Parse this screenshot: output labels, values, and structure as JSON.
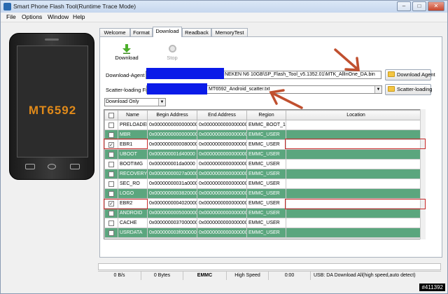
{
  "window": {
    "title": "Smart Phone Flash Tool(Runtime Trace Mode)",
    "controls": {
      "minimize": "–",
      "maximize": "□",
      "close": "✕"
    }
  },
  "menu": [
    "File",
    "Options",
    "Window",
    "Help"
  ],
  "phone": {
    "brand": "MT6592"
  },
  "tabs": [
    {
      "label": "Welcome",
      "active": false
    },
    {
      "label": "Format",
      "active": false
    },
    {
      "label": "Download",
      "active": true
    },
    {
      "label": "Readback",
      "active": false
    },
    {
      "label": "MemoryTest",
      "active": false
    }
  ],
  "toolbar": {
    "download_label": "Download",
    "stop_label": "Stop"
  },
  "download_agent": {
    "label": "Download-Agent",
    "value": "NEKEN N6 10GB\\SP_Flash_Tool_v5.1352.01\\MTK_AllInOne_DA.bin",
    "button": "Download Agent"
  },
  "scatter": {
    "label": "Scatter-loading File",
    "value": "MT6592_Android_scatter.txt",
    "button": "Scatter-loading"
  },
  "mode": {
    "value": "Download Only"
  },
  "table": {
    "columns": [
      "",
      "Name",
      "Begin Address",
      "End Address",
      "Region",
      "Location"
    ],
    "rows": [
      {
        "checked": false,
        "name": "PRELOADER",
        "begin": "0x0000000000000000",
        "end": "0x0000000000000000",
        "region": "EMMC_BOOT_1",
        "location": ""
      },
      {
        "checked": false,
        "name": "MBR",
        "begin": "0x0000000000000000",
        "end": "0x0000000000000000",
        "region": "EMMC_USER",
        "location": ""
      },
      {
        "checked": true,
        "name": "EBR1",
        "begin": "0x0000000000080000",
        "end": "0x0000000000000000",
        "region": "EMMC_USER",
        "location": ""
      },
      {
        "checked": false,
        "name": "UBOOT",
        "begin": "0x000000001d40000",
        "end": "0x0000000000000000",
        "region": "EMMC_USER",
        "location": ""
      },
      {
        "checked": false,
        "name": "BOOTIMG",
        "begin": "0x000000001da0000",
        "end": "0x0000000000000000",
        "region": "EMMC_USER",
        "location": ""
      },
      {
        "checked": false,
        "name": "RECOVERY",
        "begin": "0x00000000027a0000",
        "end": "0x0000000000000000",
        "region": "EMMC_USER",
        "location": ""
      },
      {
        "checked": false,
        "name": "SEC_RO",
        "begin": "0x00000000031a0000",
        "end": "0x0000000000000000",
        "region": "EMMC_USER",
        "location": ""
      },
      {
        "checked": false,
        "name": "LOGO",
        "begin": "0x0000000003820000",
        "end": "0x0000000000000000",
        "region": "EMMC_USER",
        "location": ""
      },
      {
        "checked": true,
        "name": "EBR2",
        "begin": "0x0000000004020000",
        "end": "0x0000000000000000",
        "region": "EMMC_USER",
        "location": ""
      },
      {
        "checked": false,
        "name": "ANDROID",
        "begin": "0x0000000005000000",
        "end": "0x0000000000000000",
        "region": "EMMC_USER",
        "location": ""
      },
      {
        "checked": false,
        "name": "CACHE",
        "begin": "0x0000000037000000",
        "end": "0x0000000000000000",
        "region": "EMMC_USER",
        "location": ""
      },
      {
        "checked": false,
        "name": "USRDATA",
        "begin": "0x000000003f000000",
        "end": "0x0000000000000000",
        "region": "EMMC_USER",
        "location": ""
      }
    ]
  },
  "status": {
    "speed": "0 B/s",
    "bytes": "0 Bytes",
    "storage": "EMMC",
    "mode": "High Speed",
    "time": "0:00",
    "info": "USB: DA Download All(high speed,auto detect)"
  },
  "watermark": "#411392",
  "colors": {
    "row_green": "#5ba67e",
    "redact": "#0a1be8",
    "highlight_red": "#c72a2a",
    "arrow": "#c0502f",
    "phone_brand": "#e08a1a"
  }
}
